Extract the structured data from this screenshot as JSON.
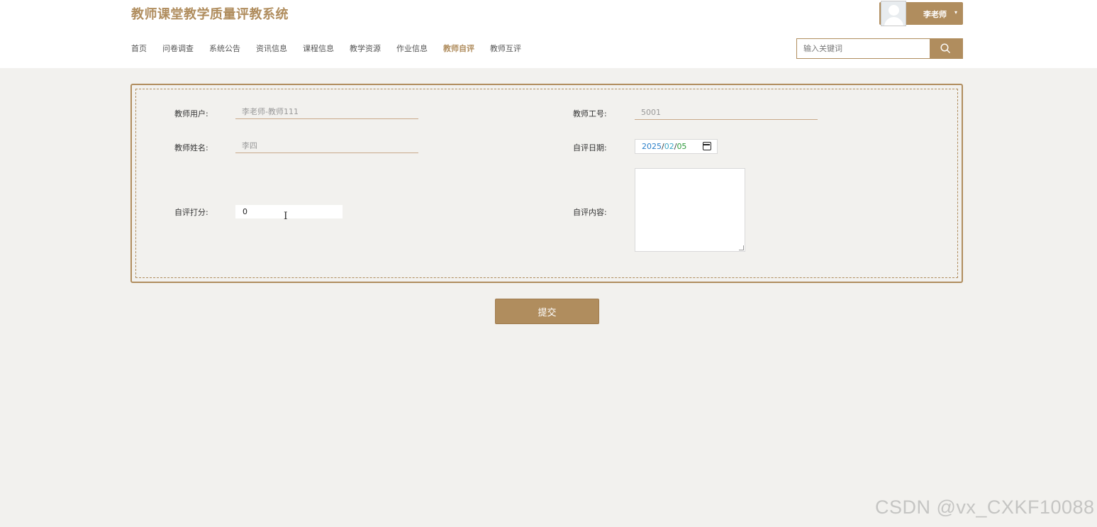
{
  "header": {
    "site_title": "教师课堂教学质量评教系统",
    "user_name": "李老师",
    "user_caret": "▾",
    "search_placeholder": "输入关键词"
  },
  "nav": {
    "items": [
      {
        "label": "首页",
        "active": false
      },
      {
        "label": "问卷调查",
        "active": false
      },
      {
        "label": "系统公告",
        "active": false
      },
      {
        "label": "资讯信息",
        "active": false
      },
      {
        "label": "课程信息",
        "active": false
      },
      {
        "label": "教学资源",
        "active": false
      },
      {
        "label": "作业信息",
        "active": false
      },
      {
        "label": "教师自评",
        "active": true
      },
      {
        "label": "教师互评",
        "active": false
      }
    ]
  },
  "form": {
    "teacher_user_label": "教师用户:",
    "teacher_user_value": "李老师-教师111",
    "teacher_id_label": "教师工号:",
    "teacher_id_value": "5001",
    "teacher_name_label": "教师姓名:",
    "teacher_name_value": "李四",
    "eval_date_label": "自评日期:",
    "eval_date": {
      "year": "2025",
      "month": "02",
      "day": "05",
      "sep": "/"
    },
    "score_label": "自评打分:",
    "score_value": "0",
    "content_label": "自评内容:",
    "content_value": ""
  },
  "submit_label": "提交",
  "watermark": "CSDN @vx_CXKF10088",
  "colors": {
    "accent": "#b08d5e",
    "background": "#f2f1ee"
  }
}
